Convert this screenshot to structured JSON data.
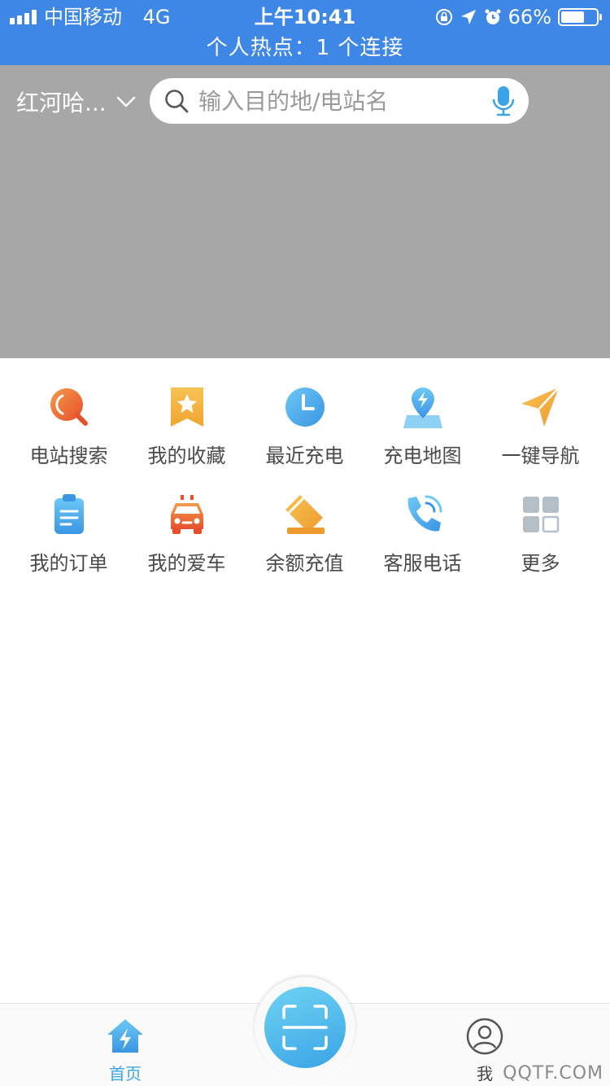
{
  "status_bar": {
    "carrier": "中国移动",
    "network": "4G",
    "time": "上午10:41",
    "battery_percent": "66%",
    "battery_level": 0.66,
    "hotspot_text": "个人热点：1 个连接"
  },
  "header": {
    "city": "红河哈...",
    "search_placeholder": "输入目的地/电站名"
  },
  "grid": {
    "items": [
      {
        "label": "电站搜索",
        "icon": "station-search-icon"
      },
      {
        "label": "我的收藏",
        "icon": "favorites-icon"
      },
      {
        "label": "最近充电",
        "icon": "clock-icon"
      },
      {
        "label": "充电地图",
        "icon": "map-icon"
      },
      {
        "label": "一键导航",
        "icon": "navigation-icon"
      },
      {
        "label": "我的订单",
        "icon": "clipboard-icon"
      },
      {
        "label": "我的爱车",
        "icon": "car-icon"
      },
      {
        "label": "余额充值",
        "icon": "card-icon"
      },
      {
        "label": "客服电话",
        "icon": "phone-icon"
      },
      {
        "label": "更多",
        "icon": "grid-icon"
      }
    ]
  },
  "tab_bar": {
    "home_label": "首页",
    "me_label": "我"
  },
  "watermark": "QQTF.COM",
  "colors": {
    "status_bar": "#3e87e6",
    "map_placeholder": "#a7a7a7",
    "accent": "#3aa4e6"
  }
}
